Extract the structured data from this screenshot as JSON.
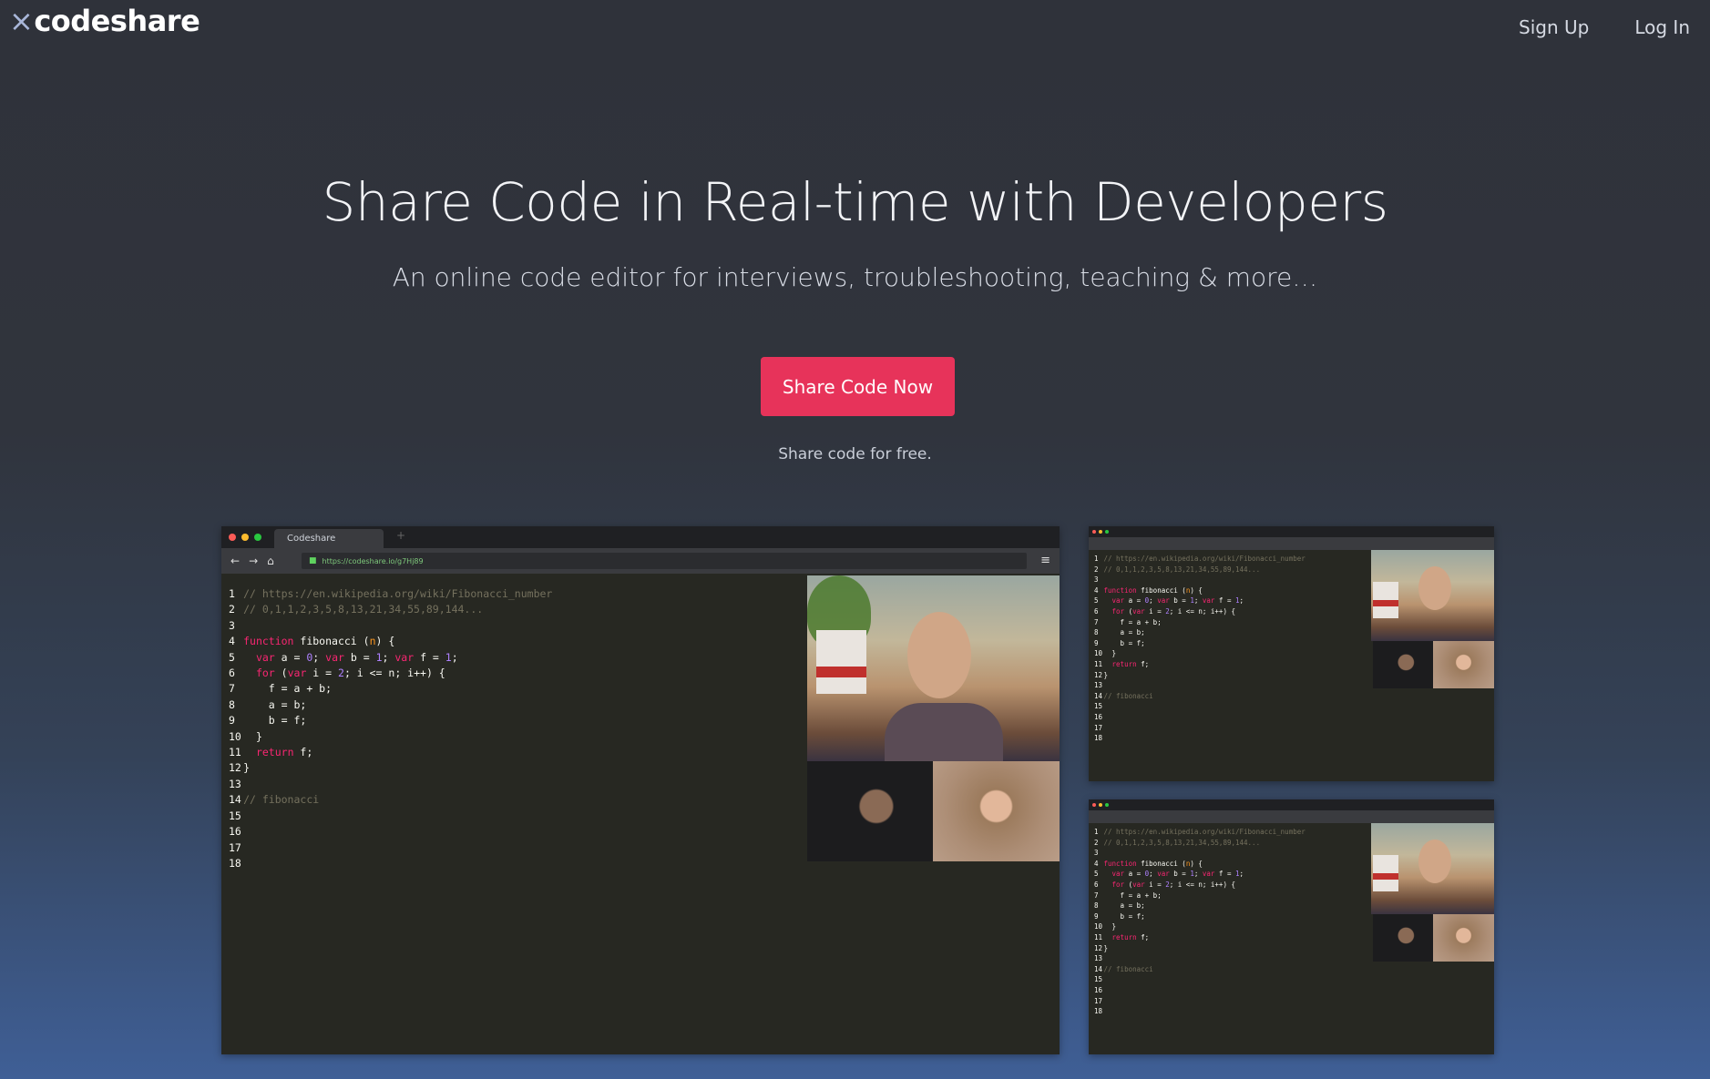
{
  "header": {
    "logo_mark": "×",
    "logo_text": "codeshare",
    "nav": [
      "Sign Up",
      "Log In"
    ]
  },
  "hero": {
    "title": "Share Code in Real-time with Developers",
    "subtitle": "An online code editor for interviews, troubleshooting, teaching & more…",
    "cta_label": "Share Code Now",
    "note": "Share code for free."
  },
  "browser": {
    "tab_title": "Codeshare",
    "url": "https://codeshare.io/g7Hj89"
  },
  "code_lines": [
    "// https://en.wikipedia.org/wiki/Fibonacci_number",
    "// 0,1,1,2,3,5,8,13,21,34,55,89,144...",
    "",
    "function fibonacci (n) {",
    "  var a = 0; var b = 1; var f = 1;",
    "  for (var i = 2; i <= n; i++) {",
    "    f = a + b;",
    "    a = b;",
    "    b = f;",
    "  }",
    "  return f;",
    "}",
    "",
    "// fibonacci",
    "",
    "",
    "",
    ""
  ],
  "colors": {
    "cta": "#e7335a",
    "editor_bg": "#272822",
    "comment": "#75715e",
    "keyword": "#f92672",
    "number": "#ae81ff"
  }
}
